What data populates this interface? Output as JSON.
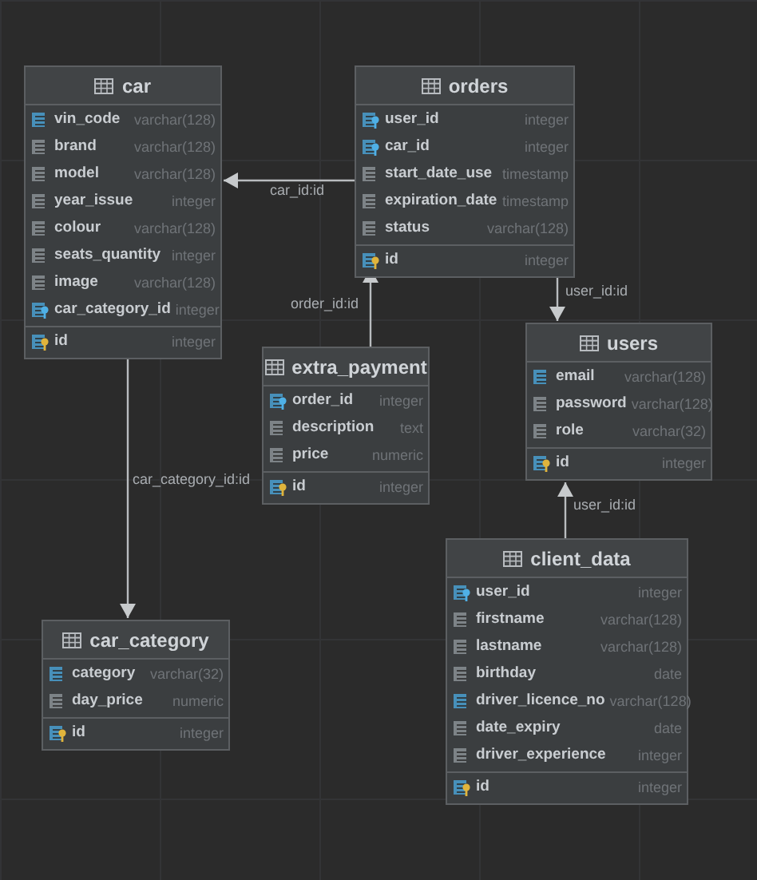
{
  "tables": [
    {
      "name": "car",
      "columns": [
        {
          "name": "vin_code",
          "type": "varchar(128)",
          "kind": "unique"
        },
        {
          "name": "brand",
          "type": "varchar(128)",
          "kind": "column"
        },
        {
          "name": "model",
          "type": "varchar(128)",
          "kind": "column"
        },
        {
          "name": "year_issue",
          "type": "integer",
          "kind": "column"
        },
        {
          "name": "colour",
          "type": "varchar(128)",
          "kind": "column"
        },
        {
          "name": "seats_quantity",
          "type": "integer",
          "kind": "column"
        },
        {
          "name": "image",
          "type": "varchar(128)",
          "kind": "column"
        },
        {
          "name": "car_category_id",
          "type": "integer",
          "kind": "fk"
        },
        {
          "name": "id",
          "type": "integer",
          "kind": "pk"
        }
      ]
    },
    {
      "name": "orders",
      "columns": [
        {
          "name": "user_id",
          "type": "integer",
          "kind": "fk"
        },
        {
          "name": "car_id",
          "type": "integer",
          "kind": "fk"
        },
        {
          "name": "start_date_use",
          "type": "timestamp",
          "kind": "column"
        },
        {
          "name": "expiration_date",
          "type": "timestamp",
          "kind": "column"
        },
        {
          "name": "status",
          "type": "varchar(128)",
          "kind": "column"
        },
        {
          "name": "id",
          "type": "integer",
          "kind": "pk"
        }
      ]
    },
    {
      "name": "extra_payment",
      "columns": [
        {
          "name": "order_id",
          "type": "integer",
          "kind": "fk"
        },
        {
          "name": "description",
          "type": "text",
          "kind": "column"
        },
        {
          "name": "price",
          "type": "numeric",
          "kind": "column"
        },
        {
          "name": "id",
          "type": "integer",
          "kind": "pk"
        }
      ]
    },
    {
      "name": "users",
      "columns": [
        {
          "name": "email",
          "type": "varchar(128)",
          "kind": "unique"
        },
        {
          "name": "password",
          "type": "varchar(128)",
          "kind": "column"
        },
        {
          "name": "role",
          "type": "varchar(32)",
          "kind": "column"
        },
        {
          "name": "id",
          "type": "integer",
          "kind": "pk"
        }
      ]
    },
    {
      "name": "client_data",
      "columns": [
        {
          "name": "user_id",
          "type": "integer",
          "kind": "fk"
        },
        {
          "name": "firstname",
          "type": "varchar(128)",
          "kind": "column"
        },
        {
          "name": "lastname",
          "type": "varchar(128)",
          "kind": "column"
        },
        {
          "name": "birthday",
          "type": "date",
          "kind": "column"
        },
        {
          "name": "driver_licence_no",
          "type": "varchar(128)",
          "kind": "unique"
        },
        {
          "name": "date_expiry",
          "type": "date",
          "kind": "column"
        },
        {
          "name": "driver_experience",
          "type": "integer",
          "kind": "column"
        },
        {
          "name": "id",
          "type": "integer",
          "kind": "pk"
        }
      ]
    },
    {
      "name": "car_category",
      "columns": [
        {
          "name": "category",
          "type": "varchar(32)",
          "kind": "unique"
        },
        {
          "name": "day_price",
          "type": "numeric",
          "kind": "column"
        },
        {
          "name": "id",
          "type": "integer",
          "kind": "pk"
        }
      ]
    }
  ],
  "relations": [
    {
      "label": "car_id:id"
    },
    {
      "label": "order_id:id"
    },
    {
      "label": "user_id:id"
    },
    {
      "label": "user_id:id"
    },
    {
      "label": "car_category_id:id"
    }
  ]
}
